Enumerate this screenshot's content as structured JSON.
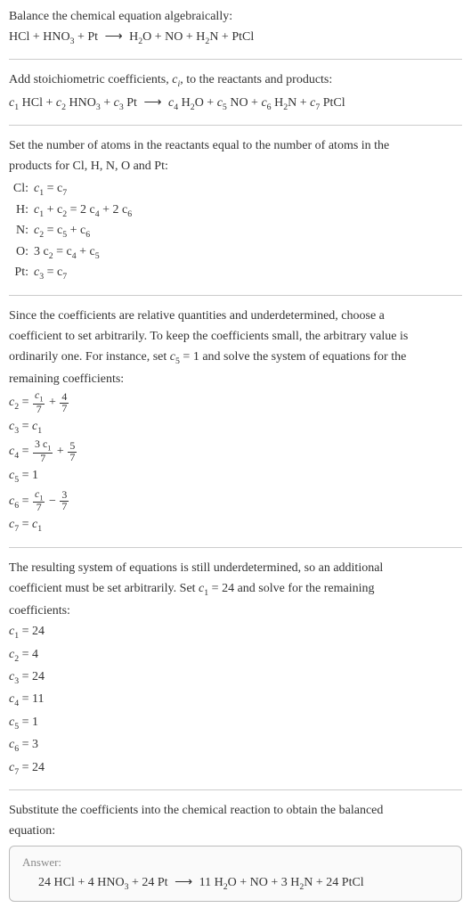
{
  "intro": {
    "title": "Balance the chemical equation algebraically:",
    "equation_lhs": "HCl + HNO",
    "equation_rhs_1": " + Pt ",
    "equation_rhs_2": " H",
    "equation_rhs_3": "O + NO + H",
    "equation_rhs_4": "N + PtCl"
  },
  "step1": {
    "title": "Add stoichiometric coefficients, ",
    "title_var": "c",
    "title_sub": "i",
    "title_end": ", to the reactants and products:",
    "eq_c1": "c",
    "eq_parts": {
      "p1": " HCl + ",
      "p2": " HNO",
      "p3": " + ",
      "p4": " Pt ",
      "p5": " ",
      "p6": " H",
      "p7": "O + ",
      "p8": " NO + ",
      "p9": " H",
      "p10": "N + ",
      "p11": " PtCl"
    }
  },
  "step2": {
    "title1": "Set the number of atoms in the reactants equal to the number of atoms in the",
    "title2": "products for Cl, H, N, O and Pt:",
    "atoms": [
      {
        "label": "Cl:",
        "eq_pre": "c",
        "eq_s1": "1",
        "eq_mid": " = c",
        "eq_s2": "7",
        "eq_post": ""
      },
      {
        "label": "H:",
        "eq_pre": "c",
        "eq_s1": "1",
        "eq_mid": " + c",
        "eq_s2": "2",
        "eq_mid2": " = 2 c",
        "eq_s3": "4",
        "eq_mid3": " + 2 c",
        "eq_s4": "6"
      },
      {
        "label": "N:",
        "eq_pre": "c",
        "eq_s1": "2",
        "eq_mid": " = c",
        "eq_s2": "5",
        "eq_mid2": " + c",
        "eq_s3": "6"
      },
      {
        "label": "O:",
        "eq_pre": "3 c",
        "eq_s1": "2",
        "eq_mid": " = c",
        "eq_s2": "4",
        "eq_mid2": " + c",
        "eq_s3": "5"
      },
      {
        "label": "Pt:",
        "eq_pre": "c",
        "eq_s1": "3",
        "eq_mid": " = c",
        "eq_s2": "7"
      }
    ]
  },
  "step3": {
    "p1": "Since the coefficients are relative quantities and underdetermined, choose a",
    "p2": "coefficient to set arbitrarily. To keep the coefficients small, the arbitrary value is",
    "p3_a": "ordinarily one. For instance, set ",
    "p3_b": " = 1 and solve the system of equations for the",
    "p4": "remaining coefficients:",
    "c5var": "c",
    "c5sub": "5",
    "coeffs": {
      "c2": {
        "lhs_var": "c",
        "lhs_sub": "2",
        "eq": " = ",
        "f1num": "c",
        "f1numsub": "1",
        "f1den": "7",
        "plus": " + ",
        "f2num": "4",
        "f2den": "7"
      },
      "c3": {
        "lhs_var": "c",
        "lhs_sub": "3",
        "eq": " = ",
        "rhs_var": "c",
        "rhs_sub": "1"
      },
      "c4": {
        "lhs_var": "c",
        "lhs_sub": "4",
        "eq": " = ",
        "f1num": "3 c",
        "f1numsub": "1",
        "f1den": "7",
        "plus": " + ",
        "f2num": "5",
        "f2den": "7"
      },
      "c5": {
        "lhs_var": "c",
        "lhs_sub": "5",
        "eq": " = 1"
      },
      "c6": {
        "lhs_var": "c",
        "lhs_sub": "6",
        "eq": " = ",
        "f1num": "c",
        "f1numsub": "1",
        "f1den": "7",
        "minus": " − ",
        "f2num": "3",
        "f2den": "7"
      },
      "c7": {
        "lhs_var": "c",
        "lhs_sub": "7",
        "eq": " = ",
        "rhs_var": "c",
        "rhs_sub": "1"
      }
    }
  },
  "step4": {
    "p1": "The resulting system of equations is still underdetermined, so an additional",
    "p2_a": "coefficient must be set arbitrarily. Set ",
    "p2_b": " = 24 and solve for the remaining",
    "p3": "coefficients:",
    "c1var": "c",
    "c1sub": "1",
    "results": [
      {
        "var": "c",
        "sub": "1",
        "val": " = 24"
      },
      {
        "var": "c",
        "sub": "2",
        "val": " = 4"
      },
      {
        "var": "c",
        "sub": "3",
        "val": " = 24"
      },
      {
        "var": "c",
        "sub": "4",
        "val": " = 11"
      },
      {
        "var": "c",
        "sub": "5",
        "val": " = 1"
      },
      {
        "var": "c",
        "sub": "6",
        "val": " = 3"
      },
      {
        "var": "c",
        "sub": "7",
        "val": " = 24"
      }
    ]
  },
  "step5": {
    "p1": "Substitute the coefficients into the chemical reaction to obtain the balanced",
    "p2": "equation:"
  },
  "answer": {
    "title": "Answer:",
    "eq_a": "24 HCl + 4 HNO",
    "eq_b": " + 24 Pt ",
    "eq_c": " 11 H",
    "eq_d": "O + NO + 3 H",
    "eq_e": "N + 24 PtCl"
  },
  "arrow": "⟶",
  "sub2": "2",
  "sub3": "3"
}
